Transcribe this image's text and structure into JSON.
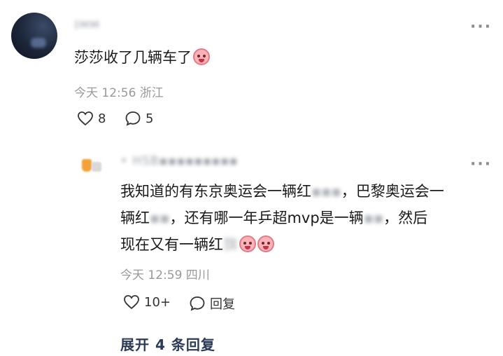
{
  "top_comment": {
    "username": "ɪᴍᴍ",
    "text": "莎莎收了几辆车了",
    "meta": "今天 12:56 浙江",
    "likes": "8",
    "replies": "5",
    "more": "···"
  },
  "reply": {
    "username": "• HSB▪▪▪▪▪▪▪▪▪",
    "line1_a": "我知道的有东京奥运会一辆红",
    "line1_blur": "▪▪▪",
    "line1_b": "，巴黎奥运会一",
    "line2_a": "辆红",
    "line2_blur": "▪▪",
    "line2_b": "，还有哪一年乒超mvp是一辆",
    "line2_blur2": "▪▪",
    "line2_c": "，然后",
    "line3_a": "现在又有一辆红",
    "line3_blur": "旗",
    "meta": "今天 12:59 四川",
    "likes": "10+",
    "reply_label": "回复",
    "more": "···"
  },
  "expand_label": "展开 4 条回复",
  "colors": {
    "accent_link": "#2b3a55",
    "meta_gray": "#999999"
  },
  "icons": [
    "heart-icon",
    "comment-bubble-icon",
    "more-options-icon",
    "emoji-crying-face-icon"
  ]
}
